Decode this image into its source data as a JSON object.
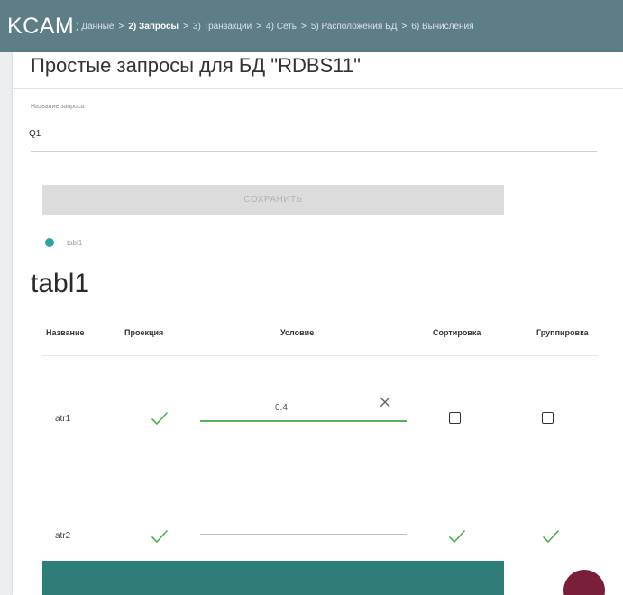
{
  "app": {
    "brand": "KCAM"
  },
  "breadcrumbs": [
    {
      "label": ") Данные",
      "active": false
    },
    {
      "label": "2) Запросы",
      "active": true
    },
    {
      "label": "3) Транзакции",
      "active": false
    },
    {
      "label": "4) Сеть",
      "active": false
    },
    {
      "label": "5) Расположения БД",
      "active": false
    },
    {
      "label": "6) Вычисления",
      "active": false
    }
  ],
  "page": {
    "title": "Простые запросы для БД \"RDBS11\""
  },
  "query_name": {
    "label": "Название запроса",
    "value": "Q1"
  },
  "save_button": {
    "label": "СОХРАНИТЬ"
  },
  "table_selector": {
    "label": "tabl1",
    "selected": true
  },
  "table": {
    "title": "tabl1",
    "columns": [
      "Название",
      "Проекция",
      "Условие",
      "Сортировка",
      "Группировка"
    ],
    "rows": [
      {
        "name": "atr1",
        "projection": true,
        "condition": "0.4",
        "sort": false,
        "group": false
      },
      {
        "name": "atr2",
        "projection": true,
        "condition": "",
        "sort": true,
        "group": true
      }
    ]
  },
  "colors": {
    "topbar": "#5d7e87",
    "accent_teal": "#2aa6a0",
    "check_green": "#4caf50",
    "condition_active_line": "#5cae5a",
    "bottom_button": "#2e7d78",
    "fab": "#7a1f3a"
  },
  "icons": {
    "check": "check-icon",
    "clear": "close-icon",
    "checkbox": "checkbox-empty"
  }
}
